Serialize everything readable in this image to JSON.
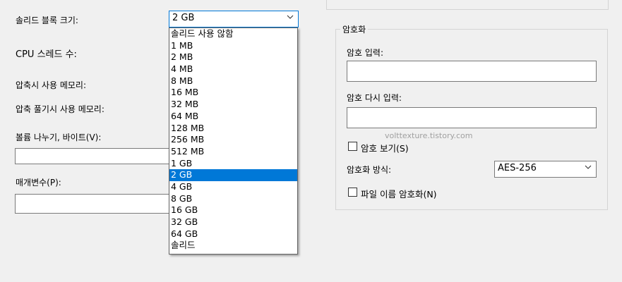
{
  "left": {
    "block_size_label": "솔리드 블록 크기:",
    "cpu_threads_label": "CPU 스레드 수:",
    "compress_mem_label": "압축시 사용 메모리:",
    "decompress_mem_label": "압축 풀기시 사용 메모리:",
    "split_label": "볼륨 나누기, 바이트(V):",
    "params_label": "매개변수(P):"
  },
  "block_size_combo": {
    "value": "2 GB",
    "options": [
      "솔리드 사용 않함",
      "1 MB",
      "2 MB",
      "4 MB",
      "8 MB",
      "16 MB",
      "32 MB",
      "64 MB",
      "128 MB",
      "256 MB",
      "512 MB",
      "1 GB",
      "2 GB",
      "4 GB",
      "8 GB",
      "16 GB",
      "32 GB",
      "64 GB",
      "솔리드"
    ],
    "selected_index": 12
  },
  "encryption": {
    "group_title": "암호화",
    "password_label": "암호 입력:",
    "password_again_label": "암호 다시 입력:",
    "show_password_label": "암호 보기(S)",
    "method_label": "암호화 방식:",
    "method_value": "AES-256",
    "encrypt_names_label": "파일 이름 암호화(N)"
  },
  "watermark": "volttexture.tistory.com",
  "icons": {
    "combo_arrow": "chevron-down-icon"
  }
}
